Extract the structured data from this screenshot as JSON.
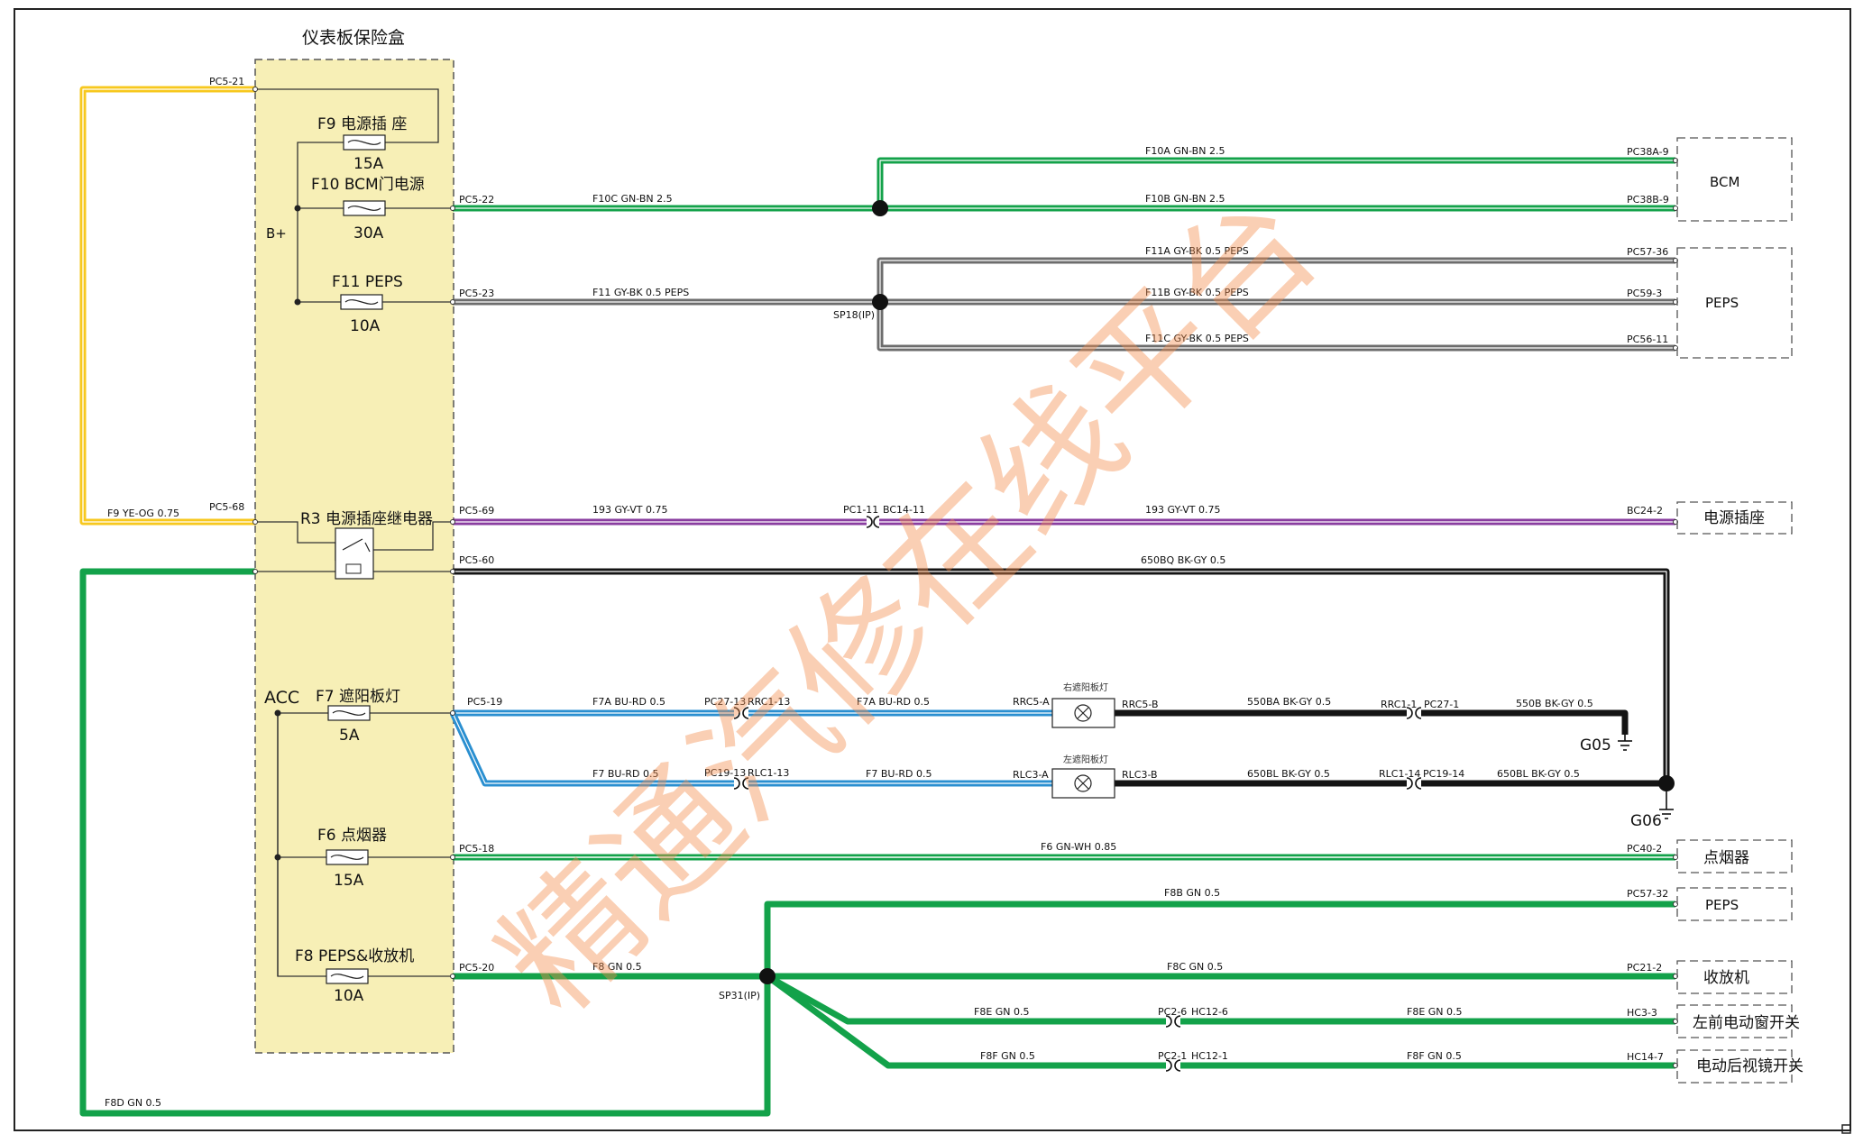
{
  "fuse_box": {
    "title": "仪表板保险盒",
    "bplus": "B+",
    "acc": "ACC"
  },
  "fuses": {
    "f9": {
      "name": "F9 电源插 座",
      "rating": "15A"
    },
    "f10": {
      "name": "F10 BCM门电源",
      "rating": "30A"
    },
    "f11": {
      "name": "F11 PEPS",
      "rating": "10A"
    },
    "r3": {
      "name": "R3 电源插座继电器"
    },
    "f7": {
      "name": "F7 遮阳板灯",
      "rating": "5A"
    },
    "f6": {
      "name": "F6 点烟器",
      "rating": "15A"
    },
    "f8": {
      "name": "F8 PEPS&收放机",
      "rating": "10A"
    }
  },
  "pins": {
    "pc5_21": "PC5-21",
    "pc5_22": "PC5-22",
    "pc5_23": "PC5-23",
    "pc5_68": "PC5-68",
    "pc5_69": "PC5-69",
    "pc5_60": "PC5-60",
    "pc5_19": "PC5-19",
    "pc5_18": "PC5-18",
    "pc5_20": "PC5-20",
    "pc38a_9": "PC38A-9",
    "pc38b_9": "PC38B-9",
    "pc57_36": "PC57-36",
    "pc59_3": "PC59-3",
    "pc56_11": "PC56-11",
    "bc24_2": "BC24-2",
    "pc40_2": "PC40-2",
    "pc57_32": "PC57-32",
    "pc21_2": "PC21-2",
    "hc3_3": "HC3-3",
    "hc14_7": "HC14-7",
    "pc1_11": "PC1-11",
    "bc14_11": "BC14-11",
    "pc27_13": "PC27-13",
    "rrc1_13": "RRC1-13",
    "pc19_13": "PC19-13",
    "rlc1_13": "RLC1-13",
    "rrc5_a": "RRC5-A",
    "rrc5_b": "RRC5-B",
    "rlc3_a": "RLC3-A",
    "rlc3_b": "RLC3-B",
    "rrc1_1": "RRC1-1",
    "pc27_1": "PC27-1",
    "rlc1_14": "RLC1-14",
    "pc19_14": "PC19-14",
    "pc2_6": "PC2-6",
    "hc12_6": "HC12-6",
    "pc2_1": "PC2-1",
    "hc12_1": "HC12-1"
  },
  "splices": {
    "sp18": "SP18(IP)",
    "sp31": "SP31(IP)"
  },
  "grounds": {
    "g05": "G05",
    "g06": "G06"
  },
  "wires": {
    "f9": "F9 YE-OG 0.75",
    "f10a": "F10A GN-BN 2.5",
    "f10b": "F10B GN-BN 2.5",
    "f10c": "F10C GN-BN 2.5",
    "f11": "F11 GY-BK 0.5 PEPS",
    "f11a": "F11A GY-BK 0.5 PEPS",
    "f11b": "F11B GY-BK 0.5 PEPS",
    "f11c": "F11C GY-BK 0.5 PEPS",
    "w193a": "193 GY-VT 0.75",
    "w193b": "193 GY-VT 0.75",
    "w650bq": "650BQ BK-GY 0.5",
    "f7a1": "F7A BU-RD 0.5",
    "f7a2": "F7A BU-RD 0.5",
    "f7_1": "F7 BU-RD 0.5",
    "f7_2": "F7 BU-RD 0.5",
    "w550ba": "550BA BK-GY 0.5",
    "w550b": "550B BK-GY 0.5",
    "w650bl1": "650BL BK-GY 0.5",
    "w650bl2": "650BL BK-GY 0.5",
    "f6": "F6 GN-WH 0.85",
    "f8b": "F8B GN 0.5",
    "f8": "F8 GN 0.5",
    "f8c": "F8C GN 0.5",
    "f8e1": "F8E GN 0.5",
    "f8e2": "F8E GN 0.5",
    "f8f1": "F8F GN 0.5",
    "f8f2": "F8F GN 0.5",
    "f8d": "F8D GN 0.5"
  },
  "modules": {
    "bcm": "BCM",
    "peps1": "PEPS",
    "socket": "电源插座",
    "lighter": "点烟器",
    "peps2": "PEPS",
    "radio": "收放机",
    "lf_window": "左前电动窗开关",
    "mirror": "电动后视镜开关"
  },
  "lamps": {
    "right": "右遮阳板灯",
    "left": "左遮阳板灯"
  },
  "watermark": "精通汽修在线平台",
  "colors": {
    "yellow": "#f7c81e",
    "green": "#13a24a",
    "grey": "#6d6d6d",
    "purple": "#8a3ea0",
    "black": "#141414",
    "blue": "#2a8fd0",
    "fusebox": "#f7efb6"
  }
}
